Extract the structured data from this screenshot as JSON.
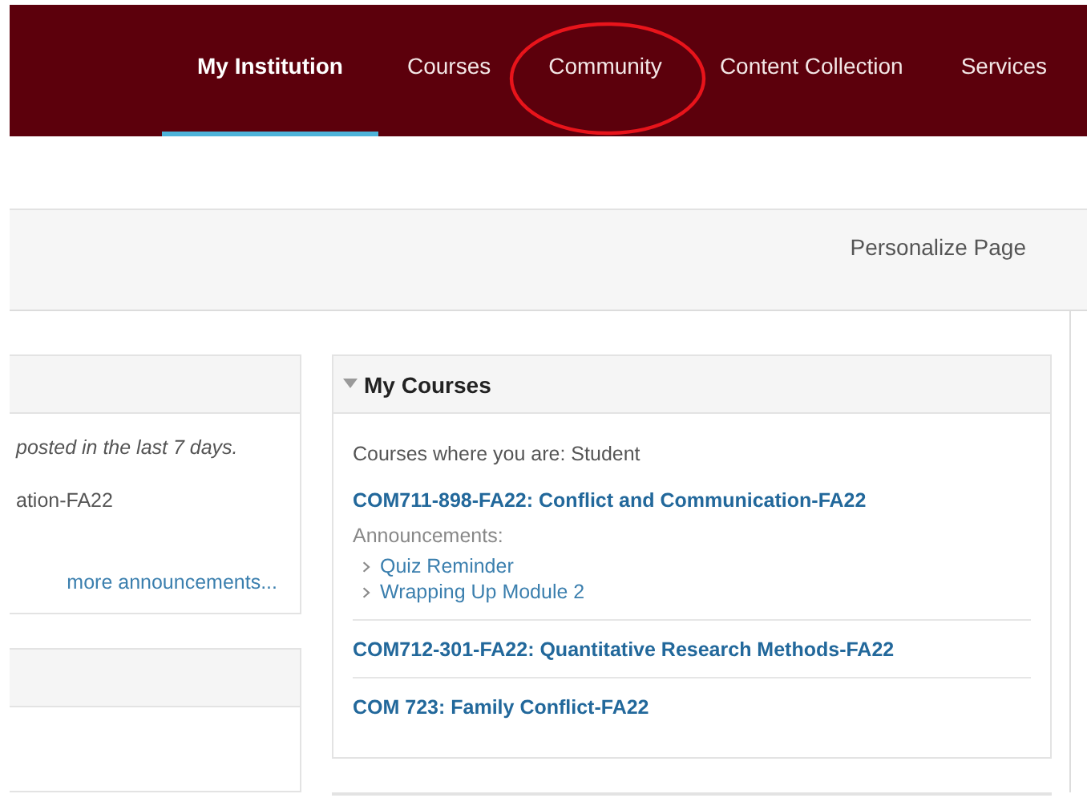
{
  "nav": {
    "tabs": [
      {
        "label": "My Institution",
        "selected": true
      },
      {
        "label": "Courses",
        "selected": false
      },
      {
        "label": "Community",
        "selected": false
      },
      {
        "label": "Content Collection",
        "selected": false
      },
      {
        "label": "Services",
        "selected": false
      }
    ]
  },
  "page_header": {
    "personalize_label": "Personalize Page"
  },
  "left_module": {
    "lines": [
      {
        "text": "posted in the last 7 days.",
        "kind": "note"
      },
      {
        "text": "ation-FA22",
        "kind": "course"
      }
    ],
    "more_link": "more announcements..."
  },
  "my_courses": {
    "title": "My Courses",
    "role_line": "Courses where you are: Student",
    "courses": [
      {
        "name": "COM711-898-FA22: Conflict and Communication-FA22",
        "announcements_label": "Announcements:",
        "announcements": [
          "Quiz Reminder",
          "Wrapping Up Module 2"
        ]
      },
      {
        "name": "COM712-301-FA22: Quantitative Research Methods-FA22"
      },
      {
        "name": "COM 723: Family Conflict-FA22"
      }
    ]
  }
}
